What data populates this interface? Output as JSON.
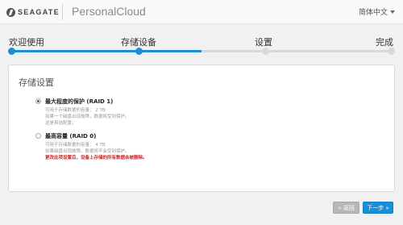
{
  "header": {
    "brand": "SEAGATE",
    "product": "PersonalCloud",
    "language": "简体中文"
  },
  "steps": [
    {
      "label": "欢迎使用",
      "state": "done"
    },
    {
      "label": "存储设备",
      "state": "current"
    },
    {
      "label": "设置",
      "state": "todo"
    },
    {
      "label": "完成",
      "state": "todo"
    }
  ],
  "progress": {
    "fraction": 0.5
  },
  "panel": {
    "title": "存储设置",
    "options": [
      {
        "title": "最大程度的保护 (RAID 1)",
        "selected": true,
        "lines": [
          "可用于存储数据的容量： 2 TB",
          "如果一个磁盘出现故障，数据将受到保护。",
          "这是首选配置。"
        ],
        "warning": ""
      },
      {
        "title": "最高容量 (RAID 0)",
        "selected": false,
        "lines": [
          "可用于存储数据的容量： 4 TB",
          "如果磁盘出现故障，数据将不会受到保护。"
        ],
        "warning": "更改此项设置后，设备上存储的所有数据会被删除。"
      }
    ]
  },
  "buttons": {
    "back": "« 返回",
    "next": "下一步 »"
  },
  "colors": {
    "accent": "#1a8fd8",
    "warning": "#c62828"
  }
}
